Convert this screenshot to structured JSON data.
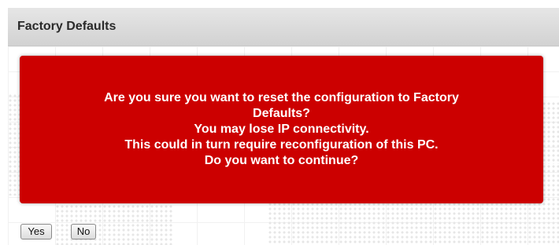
{
  "header": {
    "title": "Factory Defaults"
  },
  "alert": {
    "lines": [
      "Are you sure you want to reset the configuration to Factory",
      "Defaults?",
      "You may lose IP connectivity.",
      "This could in turn require reconfiguration of this PC.",
      "Do you want to continue?"
    ],
    "background_color": "#cc0000",
    "text_color": "#ffffff"
  },
  "buttons": {
    "yes_label": "Yes",
    "no_label": "No"
  }
}
